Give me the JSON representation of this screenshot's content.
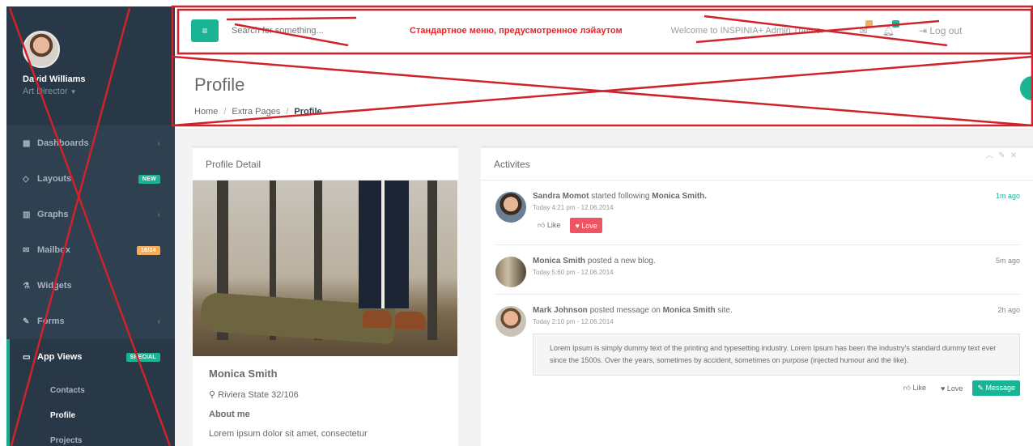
{
  "user": {
    "name": "David Williams",
    "role": "Art Director"
  },
  "sidebar": {
    "items": [
      {
        "icon": "dashboard-icon",
        "glyph": "▦",
        "label": "Dashboards",
        "arrow": true
      },
      {
        "icon": "diamond-icon",
        "glyph": "◇",
        "label": "Layouts",
        "badge": "NEW",
        "badge_color": "green"
      },
      {
        "icon": "chart-icon",
        "glyph": "▥",
        "label": "Graphs",
        "arrow": true
      },
      {
        "icon": "envelope-icon",
        "glyph": "✉",
        "label": "Mailbox",
        "badge": "16/24",
        "badge_color": "orange"
      },
      {
        "icon": "flask-icon",
        "glyph": "⚗",
        "label": "Widgets"
      },
      {
        "icon": "edit-icon",
        "glyph": "✎",
        "label": "Forms",
        "arrow": true
      }
    ],
    "active": {
      "icon": "desktop-icon",
      "glyph": "▭",
      "label": "App Views",
      "badge": "SPECIAL"
    },
    "submenu": [
      "Contacts",
      "Profile",
      "Projects"
    ]
  },
  "topbar": {
    "search_placeholder": "Search for something...",
    "note": "Стандартное меню, предусмотренное лэйаутом",
    "welcome": "Welcome to INSPINIA+ Admin Theme.",
    "logout": "Log out"
  },
  "page": {
    "title": "Profile",
    "breadcrumb": [
      "Home",
      "Extra Pages",
      "Profile"
    ]
  },
  "profile_panel": {
    "title": "Profile Detail",
    "name": "Monica Smith",
    "location": "Riviera State 32/106",
    "about_label": "About me",
    "about_text": "Lorem ipsum dolor sit amet, consectetur"
  },
  "activities": {
    "title": "Activites",
    "items": [
      {
        "who": "Sandra Momot",
        "action": " started following ",
        "target": "Monica Smith.",
        "rest": "",
        "sub": "Today 4:21 pm - 12.06.2014",
        "time": "1m ago",
        "time_green": true,
        "buttons": [
          "Like",
          "Love"
        ]
      },
      {
        "who": "Monica Smith",
        "action": " posted a new blog.",
        "target": "",
        "rest": "",
        "sub": "Today 5:60 pm - 12.06.2014",
        "time": "5m ago"
      },
      {
        "who": "Mark Johnson",
        "action": " posted message on ",
        "target": "Monica Smith",
        "rest": " site.",
        "sub": "Today 2:10 pm - 12.06.2014",
        "time": "2h ago",
        "message": "Lorem Ipsum is simply dummy text of the printing and typesetting industry. Lorem Ipsum has been the industry's standard dummy text ever since the 1500s. Over the years, sometimes by accident, sometimes on purpose (injected humour and the like).",
        "buttons": [
          "Like",
          "Love",
          "Message"
        ]
      }
    ]
  },
  "colors": {
    "sidebar": "#2f4050",
    "accent": "#1ab394",
    "cross": "#d0222a"
  }
}
